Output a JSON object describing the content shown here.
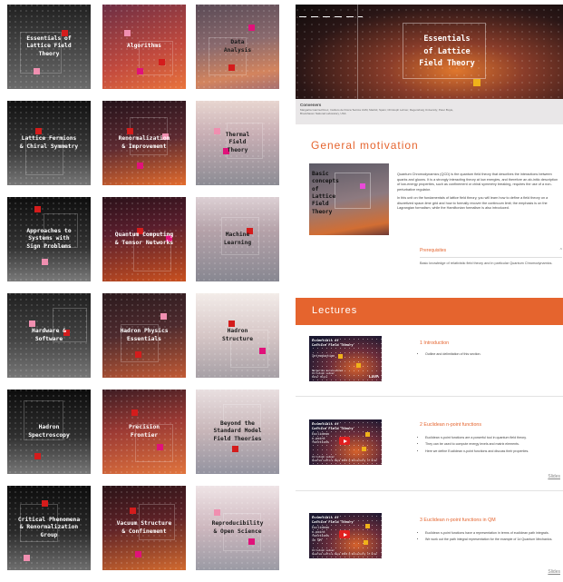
{
  "tiles": [
    {
      "title": "Essentials of\nLattice Field\nTheory"
    },
    {
      "title": "Algorithms"
    },
    {
      "title": "Data\nAnalysis"
    },
    {
      "title": "Lattice Fermions\n& Chiral Symmetry"
    },
    {
      "title": "Renormalization\n& Improvement"
    },
    {
      "title": "Thermal\nField\nTheory"
    },
    {
      "title": "Approaches to\nSystems with\nSign Problems"
    },
    {
      "title": "Quantum Computing\n& Tensor Networks"
    },
    {
      "title": "Machine\nLearning"
    },
    {
      "title": "Hardware &\nSoftware"
    },
    {
      "title": "Hadron Physics\nEssentials"
    },
    {
      "title": "Hadron\nStructure"
    },
    {
      "title": "Hadron\nSpectroscopy"
    },
    {
      "title": "Precision\nFrontier"
    },
    {
      "title": "Beyond the\nStandard Model\nField Theories"
    },
    {
      "title": "Critical Phenomena\n& Renormalization\nGroup"
    },
    {
      "title": "Vacuum Structure\n& Confinement"
    },
    {
      "title": "Reproducibility\n& Open Science"
    }
  ],
  "hero": {
    "title": "Essentials\nof Lattice\nField Theory"
  },
  "conveners": {
    "heading": "Conveners",
    "text": "Margarita García-Pérez, Instituto de Física Teórica UAM, Madrid, Spain; Christoph Lehner, Regensburg University; Peter Boyle, Brookhaven National Laboratory, USA"
  },
  "general_motivation": {
    "title": "General motivation",
    "thumb_title": "Basic\nconcepts\nof\nLattice\nField\nTheory",
    "p1": "Quantum Chromodynamics (QCD) is the quantum field theory that describes the interactions between quarks and gluons. It is a strongly interacting theory at low energies, and therefore an ab-initio description of low-energy properties, such as confinement or chiral symmetry breaking, requires the use of a non-perturbative regulator.",
    "p2": "In this unit on the fundamentals of lattice field theory, you will learn how to define a field theory on a discretized space-time grid and how to formally recover the continuum limit; the emphasis is on the Lagrangian formalism, while the Hamiltonian formalism is also introduced.",
    "prereq_label": "Prerequisites",
    "prereq_chevron": "^",
    "prereq_body": "Basic knowledge of relativistic field theory and in particular Quantum Chromodynamics."
  },
  "lectures": {
    "title": "Lectures",
    "items": [
      {
        "video_title": "Essentials of\nLattice Field Theory",
        "video_sub": "Introduction",
        "video_foot": "Margarita García-Pérez\nChristoph Lehner\nPeter Boyle",
        "logo": "LaVA",
        "title": "1 Introduction",
        "bullets": [
          "Outline and delimitation of this section."
        ],
        "slides": ""
      },
      {
        "video_title": "Essentials of\nLattice Field Theory",
        "video_sub": "Euclidean\nn-point\nfunctions",
        "video_foot": "Christoph Lehner\nQuantum Lattice Days 2024 @ University of Graz",
        "logo": "",
        "title": "2 Euclidean n-point functions",
        "bullets": [
          "Euclidean n-point functions are a powerful tool in quantum field theory.",
          "They can be used to compute energy levels and matrix elements.",
          "Here we define Euclidean n-point functions and discuss their properties."
        ],
        "slides": "Slides"
      },
      {
        "video_title": "Essentials of\nLattice Field Theory",
        "video_sub": "Euclidean\nn-point\nfunctions\nin QM",
        "video_foot": "Christoph Lehner\nQuantum Lattice Days 2024 @ University of Graz",
        "logo": "",
        "title": "3 Euclidean n-point functions in QM",
        "bullets": [
          "Euclidean n-point functions have a representation in terms of euclidean path integrals.",
          "We work out the path integral representation for the example of 1d Quantum Mechanics."
        ],
        "slides": "Slides"
      }
    ]
  },
  "colors": {
    "accent": "#e5642e",
    "red": "#d41c1c",
    "pink": "#f08fb0",
    "magenta": "#e0127a"
  }
}
